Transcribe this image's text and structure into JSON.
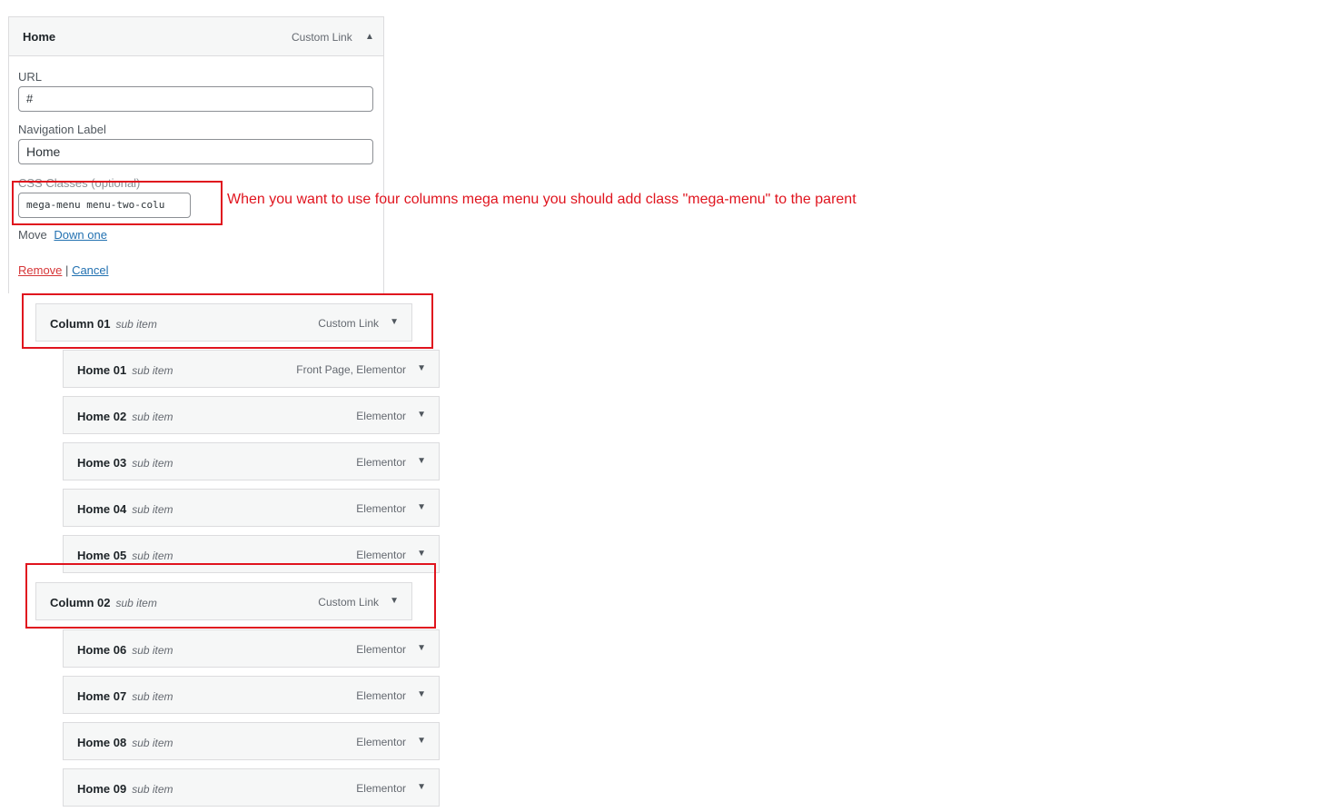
{
  "parent_item": {
    "title": "Home",
    "type": "Custom Link",
    "toggle_icon": "triangle-up-icon",
    "url_label": "URL",
    "url_value": "#",
    "nav_label_label": "Navigation Label",
    "nav_label_value": "Home",
    "css_label": "CSS Classes (optional)",
    "css_value": "mega-menu menu-two-colu",
    "move_label": "Move",
    "move_link": "Down one",
    "remove_label": "Remove",
    "separator": "|",
    "cancel_label": "Cancel"
  },
  "annotation": {
    "note": "When you want to use four columns mega menu you should add class \"mega-menu\" to the parent",
    "color": "#e0141e"
  },
  "sub_label": "sub item",
  "items": [
    {
      "title": "Column 01",
      "type": "Custom Link"
    },
    {
      "title": "Home 01",
      "type": "Front Page, Elementor"
    },
    {
      "title": "Home 02",
      "type": "Elementor"
    },
    {
      "title": "Home 03",
      "type": "Elementor"
    },
    {
      "title": "Home 04",
      "type": "Elementor"
    },
    {
      "title": "Home 05",
      "type": "Elementor"
    },
    {
      "title": "Column 02",
      "type": "Custom Link"
    },
    {
      "title": "Home 06",
      "type": "Elementor"
    },
    {
      "title": "Home 07",
      "type": "Elementor"
    },
    {
      "title": "Home 08",
      "type": "Elementor"
    },
    {
      "title": "Home 09",
      "type": "Elementor"
    }
  ]
}
